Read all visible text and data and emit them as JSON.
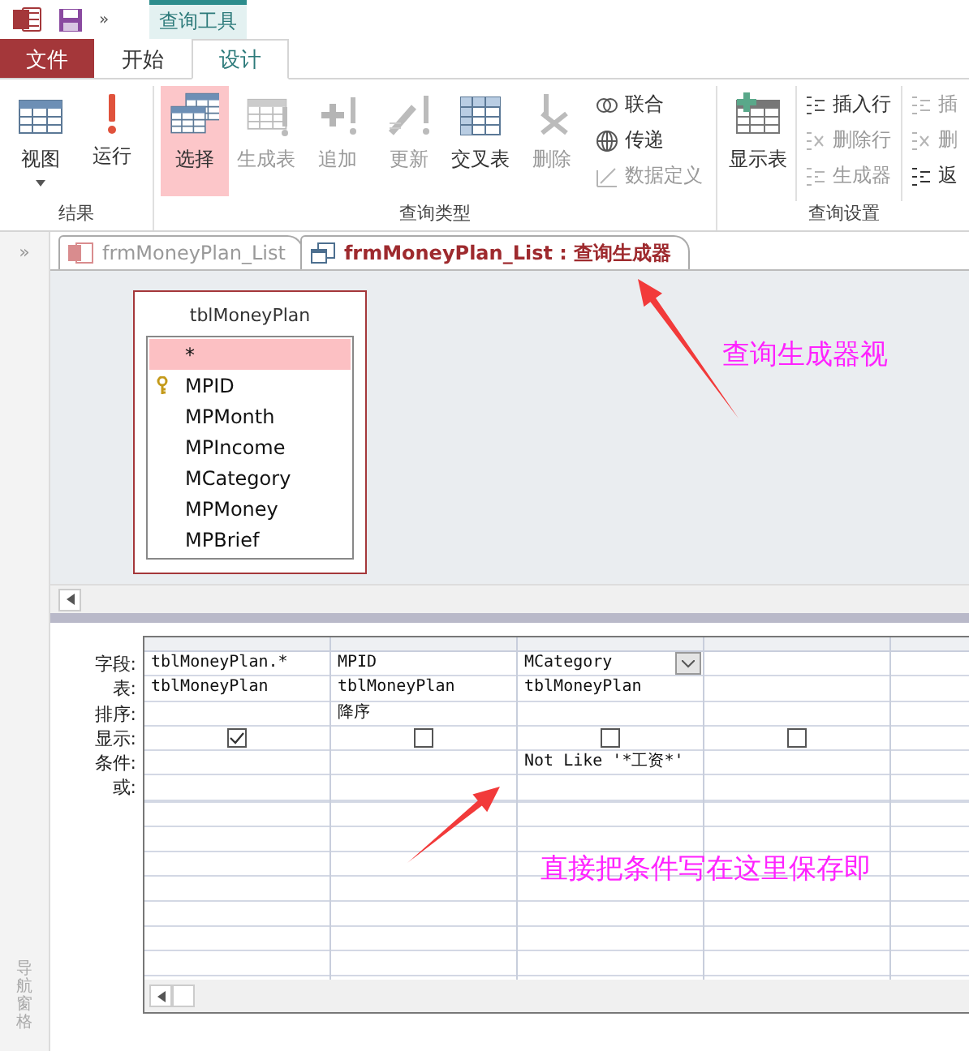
{
  "title_bar": {
    "context_tab": "查询工具",
    "more": "»"
  },
  "tabs": [
    {
      "label": "文件",
      "kind": "file",
      "selected": false
    },
    {
      "label": "开始",
      "kind": "normal",
      "selected": false
    },
    {
      "label": "设计",
      "kind": "normal",
      "selected": true
    }
  ],
  "ribbon": {
    "groups": [
      {
        "label": "结果",
        "large": [
          {
            "label": "视图",
            "selected": false,
            "disabled": false,
            "dropdown": true
          },
          {
            "label": "运行",
            "selected": false,
            "disabled": false,
            "dropdown": false
          }
        ]
      },
      {
        "label": "查询类型",
        "large": [
          {
            "label": "选择",
            "selected": true,
            "disabled": false,
            "dropdown": false
          },
          {
            "label": "生成表",
            "selected": false,
            "disabled": true,
            "dropdown": false
          },
          {
            "label": "追加",
            "selected": false,
            "disabled": true,
            "dropdown": false
          },
          {
            "label": "更新",
            "selected": false,
            "disabled": true,
            "dropdown": false
          },
          {
            "label": "交叉表",
            "selected": false,
            "disabled": false,
            "dropdown": false
          },
          {
            "label": "删除",
            "selected": false,
            "disabled": true,
            "dropdown": false
          }
        ],
        "small_columns": [
          [
            {
              "label": "联合",
              "disabled": false
            },
            {
              "label": "传递",
              "disabled": false
            },
            {
              "label": "数据定义",
              "disabled": true
            }
          ]
        ]
      },
      {
        "label": "查询设置",
        "large": [
          {
            "label": "显示表",
            "selected": false,
            "disabled": false,
            "dropdown": false
          }
        ],
        "small_columns": [
          [
            {
              "label": "插入行",
              "disabled": false
            },
            {
              "label": "删除行",
              "disabled": true
            },
            {
              "label": "生成器",
              "disabled": true
            }
          ],
          [
            {
              "label": "插",
              "disabled": true
            },
            {
              "label": "删",
              "disabled": true
            },
            {
              "label": "返",
              "disabled": false
            }
          ]
        ]
      }
    ]
  },
  "nav_pane": {
    "expand": "»",
    "label": "导航窗格"
  },
  "document_tabs": [
    {
      "label": "frmMoneyPlan_List",
      "kind": "form",
      "selected": false
    },
    {
      "label": "frmMoneyPlan_List : 查询生成器",
      "kind": "query",
      "selected": true
    }
  ],
  "table_box": {
    "title": "tblMoneyPlan",
    "fields": [
      {
        "name": "*",
        "key": false,
        "selected": true
      },
      {
        "name": "MPID",
        "key": true,
        "selected": false
      },
      {
        "name": "MPMonth",
        "key": false,
        "selected": false
      },
      {
        "name": "MPIncome",
        "key": false,
        "selected": false
      },
      {
        "name": "MCategory",
        "key": false,
        "selected": false
      },
      {
        "name": "MPMoney",
        "key": false,
        "selected": false
      },
      {
        "name": "MPBrief",
        "key": false,
        "selected": false
      }
    ]
  },
  "grid": {
    "row_labels": [
      "字段:",
      "表:",
      "排序:",
      "显示:",
      "条件:",
      "或:"
    ],
    "columns": [
      {
        "field": "tblMoneyPlan.*",
        "table": "tblMoneyPlan",
        "show": true,
        "dropdown": false
      },
      {
        "field": "MPID",
        "table": "tblMoneyPlan",
        "sort": "降序",
        "show": false,
        "dropdown": false
      },
      {
        "field": "MCategory",
        "table": "tblMoneyPlan",
        "show": false,
        "criteria": "Not Like '*工资*'",
        "dropdown": true
      },
      {
        "show": false,
        "dropdown": false
      }
    ]
  },
  "annotations": [
    "查询生成器视",
    "直接把条件写在这里保存即"
  ]
}
